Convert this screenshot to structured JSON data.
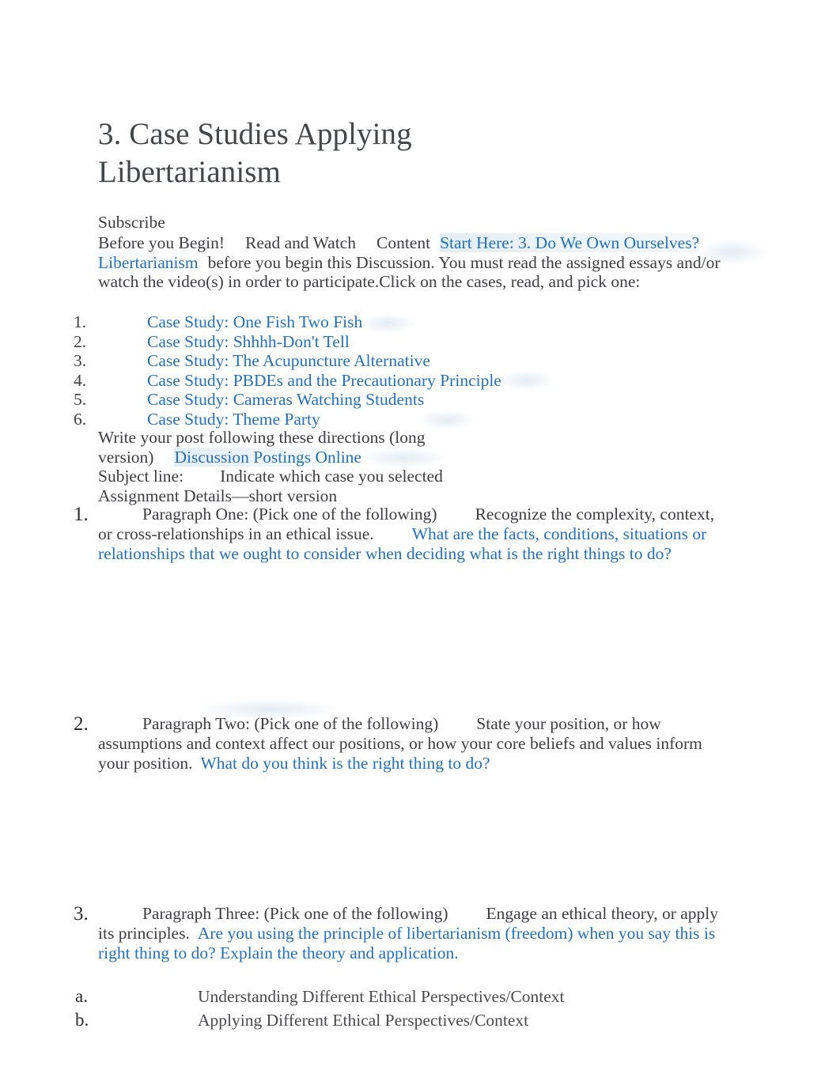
{
  "document": {
    "title": "3. Case Studies Applying Libertarianism",
    "subscribe_heading": "Subscribe"
  },
  "intro": {
    "segment_1": "Before you Begin!",
    "segment_2": "Read and Watch",
    "segment_3": "Content",
    "link_text": "Start Here: 3. Do We Own Ourselves? Libertarianism",
    "after_link": "before you begin this Discussion. You must read the assigned essays and/or watch the video(s) in order to participate.Click on the cases, read, and pick one:"
  },
  "case_studies": [
    {
      "number": "1.",
      "label": "Case Study: One Fish Two Fish"
    },
    {
      "number": "2.",
      "label": "Case Study: Shhhh-Don't Tell"
    },
    {
      "number": "3.",
      "label": "Case Study: The Acupuncture Alternative"
    },
    {
      "number": "4.",
      "label": "Case Study: PBDEs and the Precautionary Principle"
    },
    {
      "number": "5.",
      "label": "Case Study: Cameras Watching Students"
    },
    {
      "number": "6.",
      "label": "Case Study: Theme Party"
    }
  ],
  "directions": {
    "line_1": "Write your post following these directions (long",
    "line_2_prefix": "version)",
    "line_2_link": "Discussion Postings Online",
    "line_3_label": "Subject line:",
    "line_3_value": "Indicate which case you selected",
    "line_4": "Assignment Details—short version"
  },
  "paragraphs": [
    {
      "number": "1.",
      "lead": "Paragraph One: (Pick one of the following)",
      "plain": "Recognize the complexity, context, or cross-relationships in an ethical issue.",
      "prompt": "What are the facts, conditions, situations or relationships that we ought to consider when deciding what is the right things to do?"
    },
    {
      "number": "2.",
      "lead": "Paragraph Two: (Pick one of the following)",
      "plain": "State your position, or how assumptions and context affect our positions, or how your core beliefs and values inform your position.",
      "prompt": "What do you think is the right thing to do?"
    },
    {
      "number": "3.",
      "lead": "Paragraph Three: (Pick one of the following)",
      "plain": "Engage an ethical theory, or apply its principles.",
      "prompt": "Are you using the principle of libertarianism (freedom) when you say this is right thing to do? Explain the theory and application."
    }
  ],
  "lettered_items": [
    {
      "marker": "a.",
      "label": "Understanding Different Ethical Perspectives/Context"
    },
    {
      "marker": "b.",
      "label": "Applying Different Ethical Perspectives/Context"
    }
  ],
  "colors": {
    "link": "#2372b8",
    "body_text": "#3e3e42",
    "title_text": "#44474a",
    "page_background": "#ffffff"
  }
}
